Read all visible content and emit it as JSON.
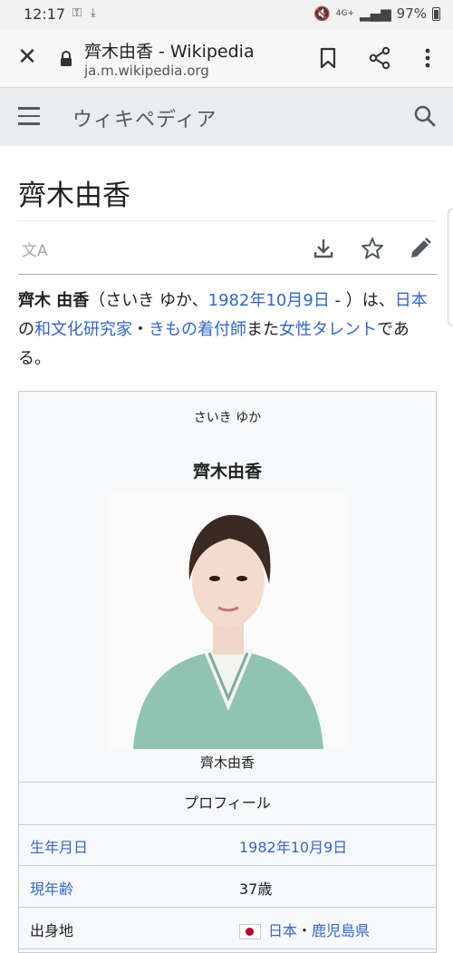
{
  "status": {
    "time": "12:17",
    "battery": "97%",
    "network": "4G+"
  },
  "browser": {
    "title": "齊木由香 - Wikipedia",
    "url": "ja.m.wikipedia.org"
  },
  "wiki": {
    "brand": "ウィキペディア"
  },
  "article": {
    "title": "齊木由香",
    "lead": {
      "name": "齊木 由香",
      "reading": "（さいき ゆか、",
      "birth_link": "1982年10月9日",
      "after_birth": " - ）は、",
      "country_link": "日本",
      "no": "の",
      "job1": "和文化研究家",
      "sep": "・",
      "job2": "きもの着付師",
      "mata": "また",
      "job3": "女性タレント",
      "end": "である。"
    }
  },
  "infobox": {
    "kana": "さいき ゆか",
    "name": "齊木由香",
    "caption": "齊木由香",
    "section": "プロフィール",
    "rows": [
      {
        "key": "生年月日",
        "value": "1982年10月9日"
      },
      {
        "key": "現年齢",
        "value": "37歳"
      },
      {
        "key": "出身地",
        "value_country": "日本",
        "value_sep": "・",
        "value_pref": "鹿児島県"
      }
    ]
  }
}
